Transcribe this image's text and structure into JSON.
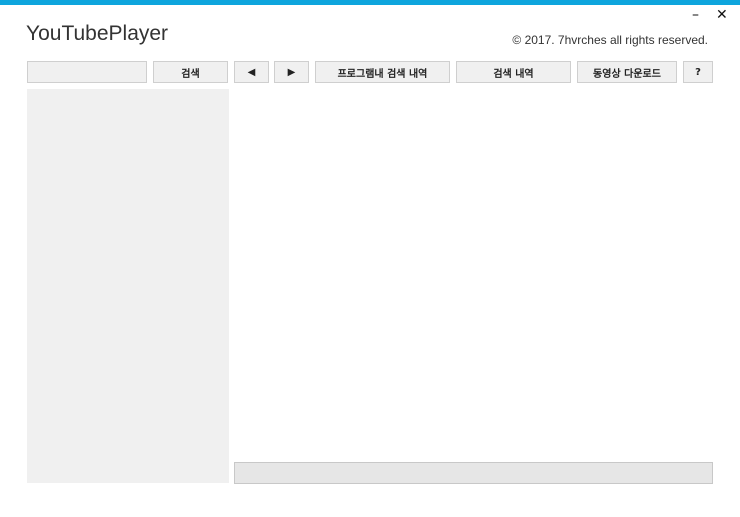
{
  "app": {
    "title": "YouTubePlayer",
    "copyright": "© 2017. 7hvrches all rights reserved."
  },
  "window_controls": {
    "minimize": "–",
    "close": "✕"
  },
  "toolbar": {
    "search_value": "",
    "search_label": "검색",
    "back_label": "◀",
    "forward_label": "▶",
    "in_app_history_label": "프로그램내 검색 내역",
    "search_history_label": "검색 내역",
    "video_download_label": "동영상 다운로드",
    "help_label": "?"
  },
  "colors": {
    "accent": "#0ea5dd",
    "panel": "#f0f0f0",
    "status_bar": "#e6e6e6"
  }
}
